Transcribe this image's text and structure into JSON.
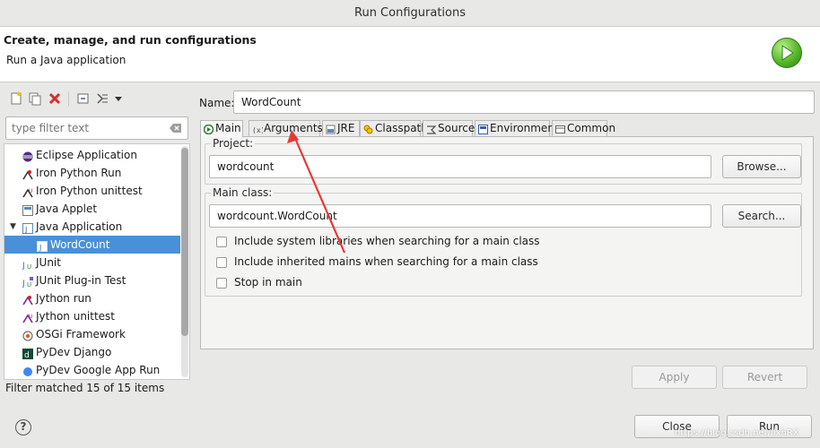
{
  "window": {
    "title": "Run Configurations"
  },
  "header": {
    "title": "Create, manage, and run configurations",
    "subtitle": "Run a Java application",
    "icon": "run-green-icon"
  },
  "left": {
    "toolbar_icons": [
      "new-config-icon",
      "duplicate-icon",
      "delete-icon",
      "collapse-all-icon",
      "filter-icon",
      "dropdown-arrow-icon"
    ],
    "filter": {
      "placeholder": "type filter text",
      "value": ""
    },
    "tree": [
      {
        "label": "Eclipse Application",
        "icon": "eclipse-icon"
      },
      {
        "label": "Iron Python Run",
        "icon": "python-run-icon"
      },
      {
        "label": "Iron Python unittest",
        "icon": "python-unittest-icon"
      },
      {
        "label": "Java Applet",
        "icon": "java-applet-icon"
      },
      {
        "label": "Java Application",
        "icon": "java-app-icon",
        "expanded": true
      },
      {
        "label": "WordCount",
        "icon": "java-app-icon",
        "selected": true
      },
      {
        "label": "JUnit",
        "icon": "junit-icon"
      },
      {
        "label": "JUnit Plug-in Test",
        "icon": "junit-plugin-icon"
      },
      {
        "label": "Jython run",
        "icon": "jython-run-icon"
      },
      {
        "label": "Jython unittest",
        "icon": "jython-unittest-icon"
      },
      {
        "label": "OSGi Framework",
        "icon": "osgi-icon"
      },
      {
        "label": "PyDev Django",
        "icon": "django-icon"
      },
      {
        "label": "PyDev Google App Run",
        "icon": "google-app-icon"
      }
    ],
    "status": "Filter matched 15 of 15 items"
  },
  "right": {
    "name_label": "Name:",
    "name_value": "WordCount",
    "tabs": [
      {
        "label": "Main",
        "icon": "main-tab-icon",
        "active": true
      },
      {
        "label": "Arguments",
        "icon": "arguments-tab-icon"
      },
      {
        "label": "JRE",
        "icon": "jre-tab-icon"
      },
      {
        "label": "Classpath",
        "icon": "classpath-tab-icon"
      },
      {
        "label": "Source",
        "icon": "source-tab-icon"
      },
      {
        "label": "Environment",
        "icon": "environment-tab-icon"
      },
      {
        "label": "Common",
        "icon": "common-tab-icon"
      }
    ],
    "project": {
      "label": "Project:",
      "value": "wordcount",
      "button": "Browse..."
    },
    "main_class": {
      "label": "Main class:",
      "value": "wordcount.WordCount",
      "button": "Search..."
    },
    "checkboxes": [
      {
        "label": "Include system libraries when searching for a main class",
        "checked": false
      },
      {
        "label": "Include inherited mains when searching for a main class",
        "checked": false
      },
      {
        "label": "Stop in main",
        "checked": false
      }
    ],
    "apply": "Apply",
    "revert": "Revert"
  },
  "footer": {
    "help": "?",
    "close": "Close",
    "run": "Run",
    "watermark": "https://blog.csdn.net/lixhRX"
  },
  "colors": {
    "selection": "#4a90d9",
    "annotation_arrow": "#e53935",
    "run_icon": "#56b82a"
  }
}
